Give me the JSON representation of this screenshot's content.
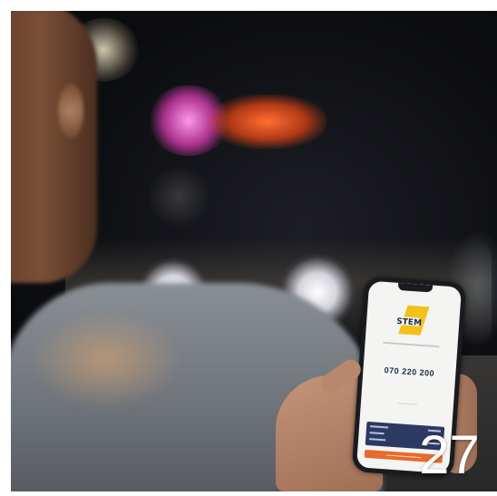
{
  "photo": {
    "page_number": "27",
    "phone_screen": {
      "brand": "STEM",
      "phone_number": "070 220 200",
      "accent_color": "#e86a2c",
      "brand_color": "#f2c21a",
      "panel_color": "#2b3a63"
    }
  }
}
